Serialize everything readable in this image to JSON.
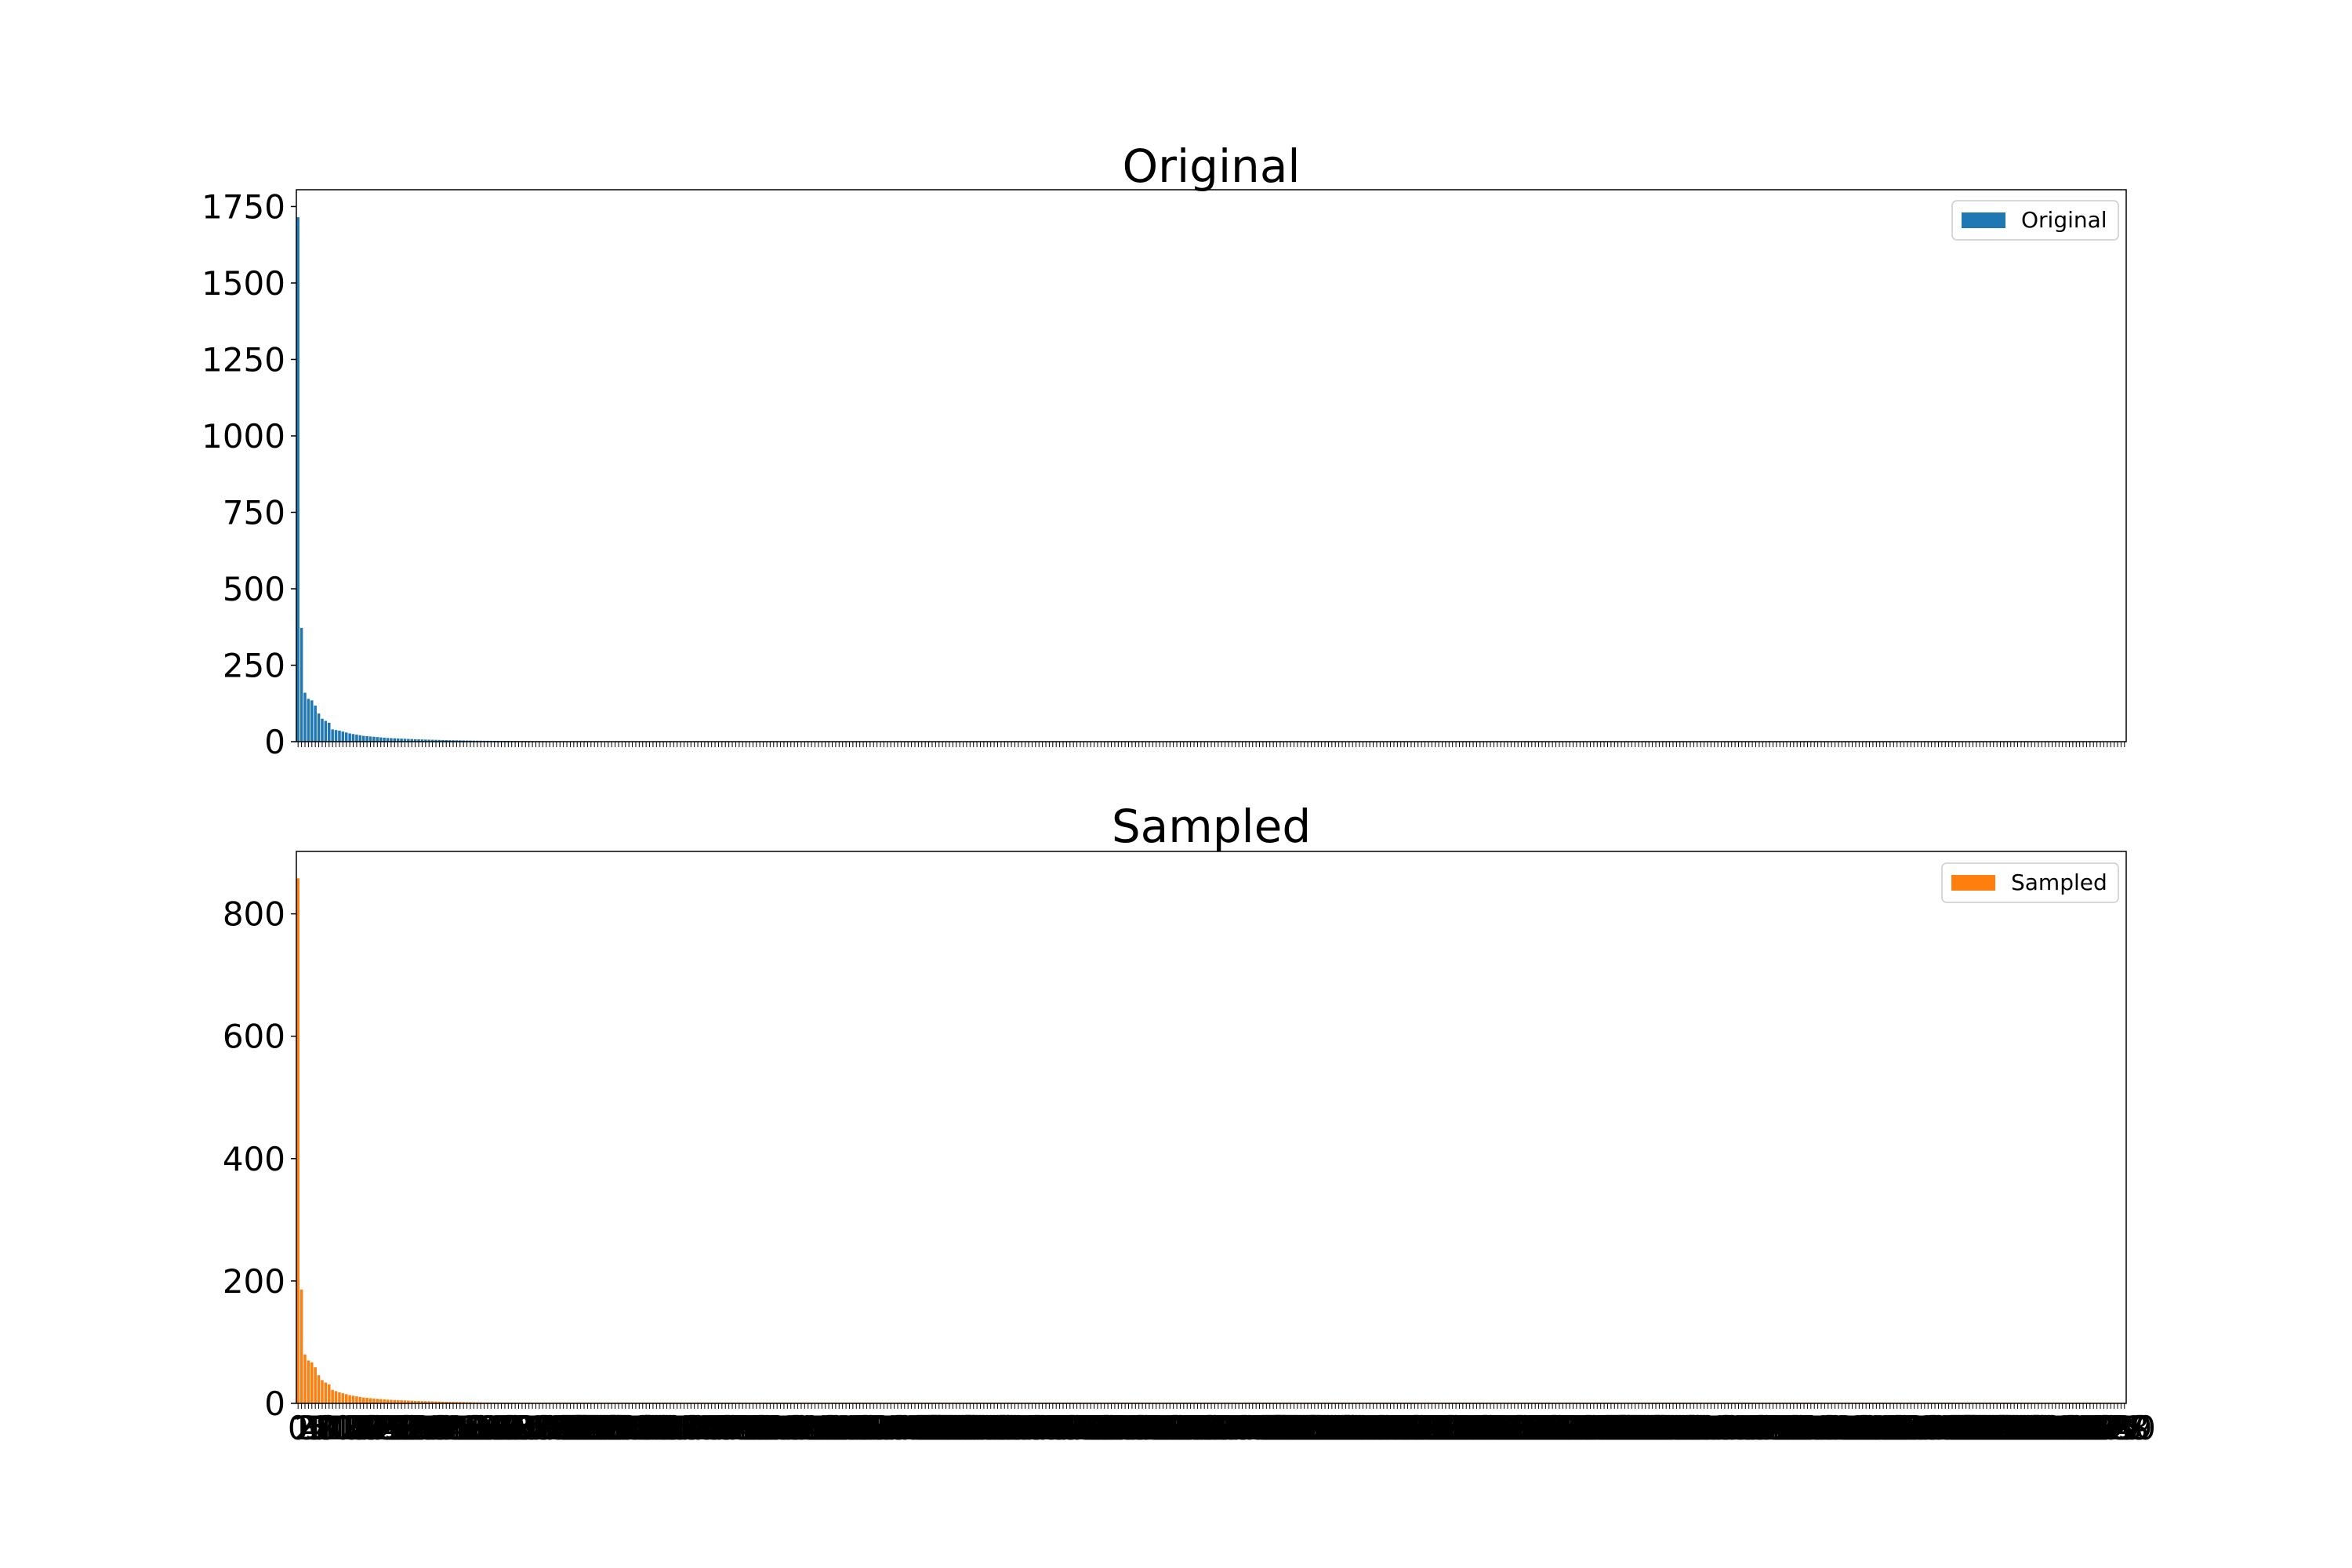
{
  "chart_data": [
    {
      "type": "bar",
      "title": "Original",
      "xlabel": "",
      "ylabel": "",
      "ylim": [
        0,
        1805
      ],
      "yticks": [
        0,
        250,
        500,
        750,
        1000,
        1250,
        1500,
        1750
      ],
      "x": "integer indices 0 to 530, one bar per index",
      "series": [
        {
          "name": "Original",
          "color": "#1f77b4",
          "values": [
            1715,
            372,
            160,
            140,
            135,
            118,
            92,
            75,
            68,
            62,
            40,
            38,
            36,
            33,
            30,
            27,
            25,
            23,
            21,
            19,
            18,
            17,
            16,
            15,
            14,
            13,
            12,
            11.5,
            11,
            10.5,
            10,
            9.5,
            9,
            8.5,
            8,
            7.6,
            7.2,
            6.9,
            6.6,
            6.3,
            6,
            5.7,
            5.4,
            5.1,
            4.8,
            4.6,
            4.4,
            4.2,
            4,
            3.8,
            3.6,
            3.4,
            3.2,
            3.1,
            3,
            2.9,
            2.8,
            2.7,
            2.6,
            2.5,
            2.4,
            2.3,
            2.2,
            2.1,
            2,
            2,
            1.9,
            1.9,
            1.8,
            1.8,
            1.7,
            1.7,
            1.6,
            1.6,
            1.5,
            1.5,
            1.4,
            1.4,
            1.3,
            1.3,
            1.2,
            1.2,
            1.1,
            1.1,
            1,
            1,
            1,
            1,
            1,
            1,
            1,
            1,
            1,
            1,
            1,
            1,
            1,
            1,
            1,
            1
          ],
          "remaining_values": "approximately 1 or less for indices 100 to 530"
        }
      ],
      "legend": {
        "placement": "upper right",
        "entries": [
          "Original"
        ]
      },
      "grid": false
    },
    {
      "type": "bar",
      "title": "Sampled",
      "xlabel": "",
      "ylabel": "",
      "ylim": [
        0,
        902
      ],
      "yticks": [
        0,
        200,
        400,
        600,
        800
      ],
      "x": "integer indices 0 to 530, one bar per index, dense overlapping tick labels",
      "series": [
        {
          "name": "Sampled",
          "color": "#ff7f0e",
          "values": [
            858,
            186,
            80,
            70,
            67,
            59,
            46,
            38,
            34,
            31,
            22,
            20,
            18,
            16.5,
            15,
            13.5,
            12.5,
            11.5,
            10.5,
            9.5,
            9,
            8.5,
            8,
            7.5,
            7,
            6.5,
            6,
            5.8,
            5.5,
            5.3,
            5,
            4.8,
            4.5,
            4.3,
            4,
            3.8,
            3.6,
            3.5,
            3.3,
            3.2,
            3,
            2.9,
            2.7,
            2.6,
            2.4,
            2.3,
            2.2,
            2.1,
            2,
            1.9,
            1.8,
            1.7,
            1.6,
            1.6,
            1.5,
            1.5,
            1.4,
            1.4,
            1.3,
            1.3,
            1.2,
            1.2,
            1.1,
            1.1,
            1,
            1,
            1,
            1,
            1,
            1,
            1,
            1,
            1,
            1,
            1,
            1,
            1,
            1,
            1,
            1,
            1,
            1,
            1,
            1,
            1,
            1,
            1,
            1,
            1,
            1,
            1,
            1,
            1,
            1,
            1,
            1,
            1,
            1,
            1,
            1
          ],
          "remaining_values": "approximately 1 or less for indices 100 to 530"
        }
      ],
      "legend": {
        "placement": "upper right",
        "entries": [
          "Sampled"
        ]
      },
      "grid": false
    }
  ]
}
